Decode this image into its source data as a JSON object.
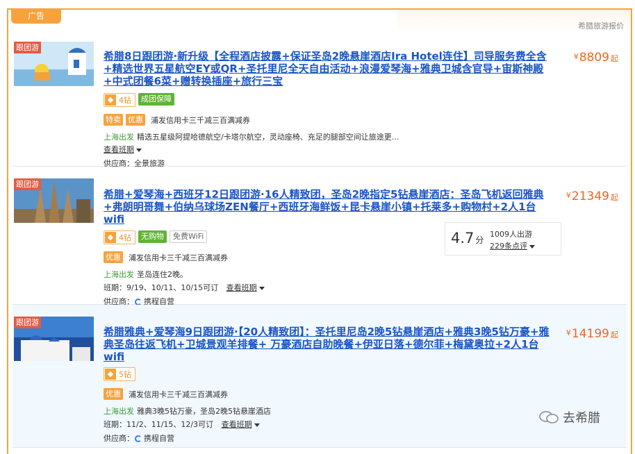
{
  "ad_label": "广告",
  "header_note": "希腊旅游报价",
  "tag_group": "跟团游",
  "items": [
    {
      "title": "希腊8日跟团游·新升级【全程酒店披露+保证圣岛2晚悬崖酒店Ira Hotel连住】司导服务费全含+精选世界五星航空EY或QR+圣托里尼全天自由活动+浪漫爱琴海+雅典卫城含官导+宙斯神殿+中式团餐6菜+赠转换插座+旅行三宝",
      "price_currency": "¥",
      "price": "8809",
      "price_suffix": "起",
      "diamond": "4钻",
      "badge_green": "成团保障",
      "promo_tags": [
        "特卖",
        "优惠"
      ],
      "promo_text": "浦发信用卡三千减三百满减券",
      "departure": "上海出发",
      "departure_text": "精选五星级阿提哈德航空/卡塔尔航空，灵动座椅、充足的腿部空间让旅途更...",
      "schedule_link": "查看班期",
      "supplier_label": "供应商：",
      "supplier": "全景旅游"
    },
    {
      "title": "希腊+爱琴海+西班牙12日跟团游·16人精致团，圣岛2晚指定5钻悬崖酒店：圣岛飞机返回雅典+弗朗明哥舞+伯纳乌球场ZEN餐厅+西班牙海鲜饭+昆卡悬崖小镇+托莱多+购物村+2人1台wifi",
      "price_currency": "¥",
      "price": "21349",
      "price_suffix": "起",
      "diamond": "4钻",
      "badge_green": "无购物",
      "badge_wifi": "免费WiFi",
      "promo_tags": [
        "优惠"
      ],
      "promo_text": "浦发信用卡三千减三百满减券",
      "departure": "上海出发",
      "departure_text": "圣岛连住2晚。",
      "schedule_label": "班期：",
      "schedule_dates": "9/19、10/11、10/15可订",
      "schedule_link": "查看班期",
      "supplier_label": "供应商：",
      "supplier": "携程自营",
      "rating": "4.7",
      "rating_unit": "分",
      "travelers": "1009人出游",
      "reviews": "229条点评"
    },
    {
      "title": "希腊雅典+爱琴海9日跟团游·【20人精致团】：圣托里尼岛2晚5钻悬崖酒店+雅典3晚5钻万豪+雅典圣岛往返飞机+卫城景观羊排餐+ 万豪酒店自助晚餐+伊亚日落+德尔菲+梅黛奥拉+2人1台wifi",
      "price_currency": "¥",
      "price": "14199",
      "price_suffix": "起",
      "diamond": "5钻",
      "promo_tags": [
        "优惠"
      ],
      "promo_text": "浦发信用卡三千减三百满减券",
      "departure": "上海出发",
      "departure_text": "雅典3晚5钻万豪，圣岛2晚5钻悬崖酒店",
      "schedule_label": "班期：",
      "schedule_dates": "11/2、11/15、12/3可订",
      "schedule_link": "查看班期",
      "supplier_label": "供应商：",
      "supplier": "携程自营"
    }
  ],
  "watermark": "去希腊"
}
